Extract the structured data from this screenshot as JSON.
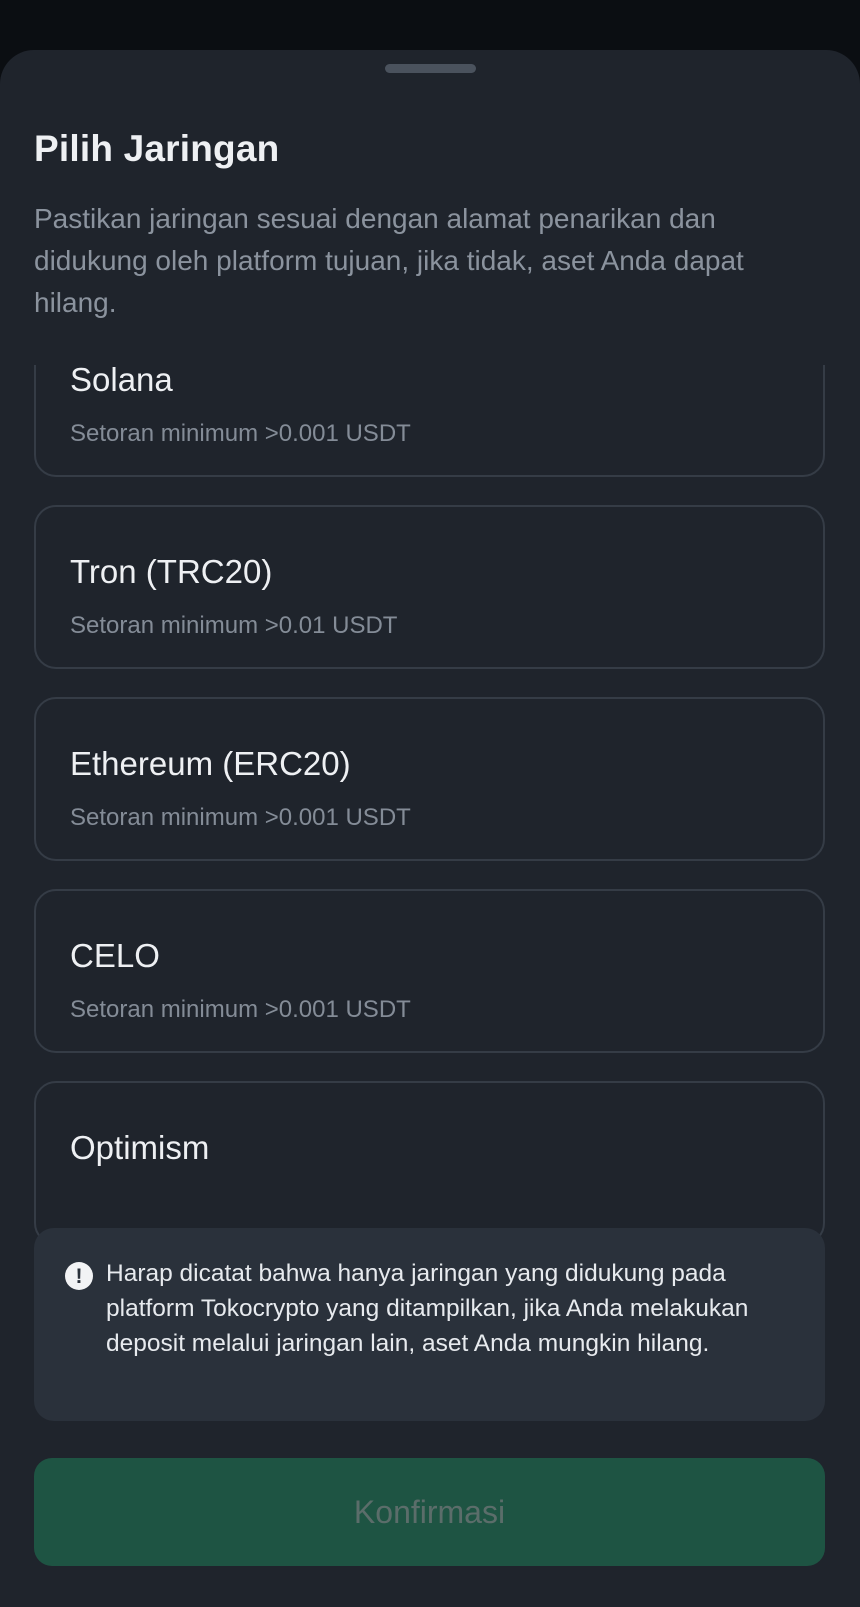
{
  "sheet": {
    "title": "Pilih Jaringan",
    "subtitle": "Pastikan jaringan sesuai dengan alamat penarikan dan didukung oleh platform tujuan, jika tidak, aset Anda dapat hilang."
  },
  "networks": [
    {
      "name": "Solana",
      "min_label": "Setoran minimum >0.001 USDT"
    },
    {
      "name": "Tron (TRC20)",
      "min_label": "Setoran minimum >0.01 USDT"
    },
    {
      "name": "Ethereum (ERC20)",
      "min_label": "Setoran minimum >0.001 USDT"
    },
    {
      "name": "CELO",
      "min_label": "Setoran minimum >0.001 USDT"
    },
    {
      "name": "Optimism",
      "min_label": ""
    }
  ],
  "notice": {
    "icon": "exclamation-circle-icon",
    "text": "Harap dicatat bahwa hanya jaringan yang didukung pada platform Tokocrypto yang ditampilkan, jika Anda melakukan deposit melalui jaringan lain, aset Anda mungkin hilang."
  },
  "confirm": {
    "label": "Konfirmasi"
  },
  "colors": {
    "sheet_bg": "#1f242c",
    "card_border": "#353c46",
    "confirm_bg": "#1e5443",
    "notice_bg": "#2a313b"
  }
}
